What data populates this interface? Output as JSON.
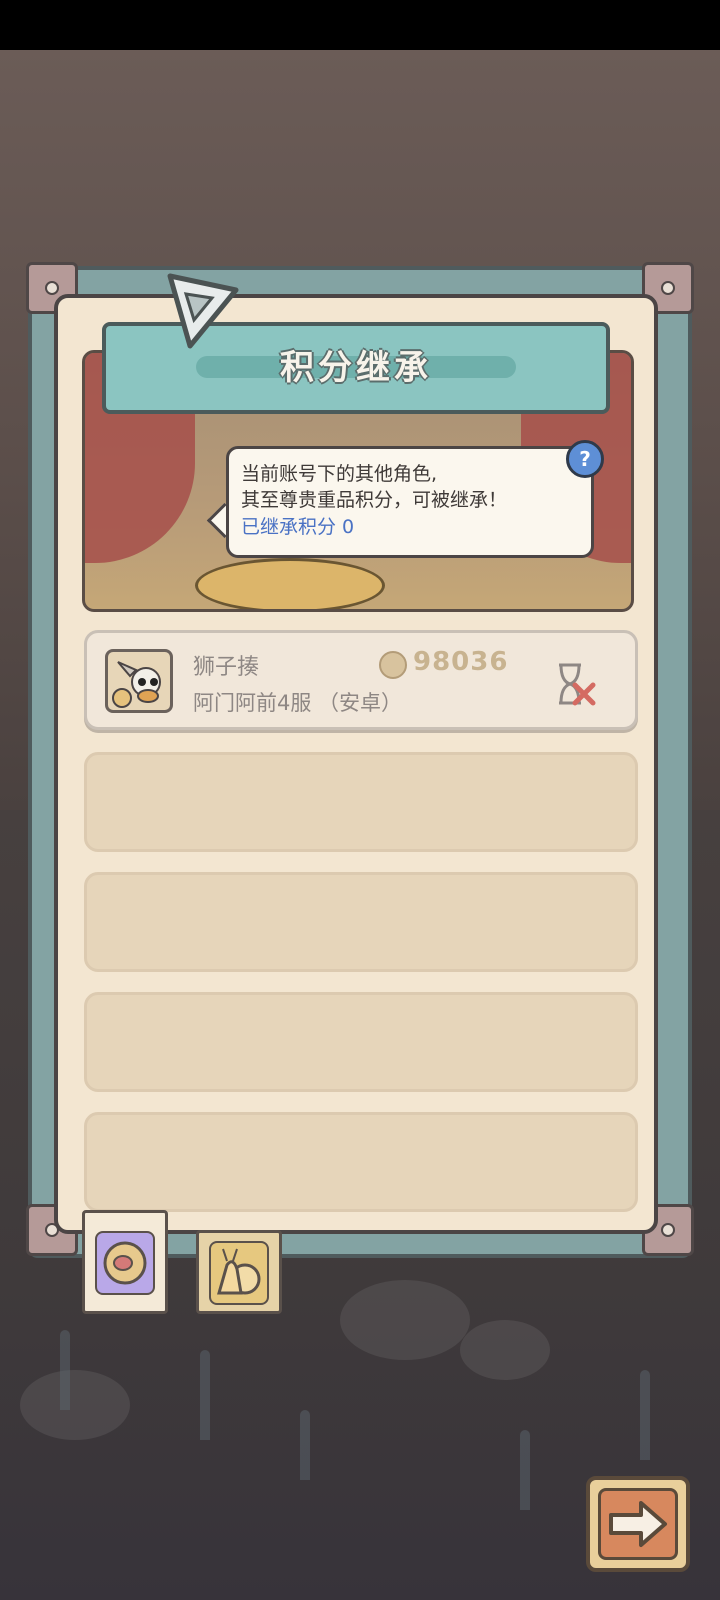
{
  "dialog": {
    "title": "积分继承",
    "message_line1": "当前账号下的其他角色,",
    "message_line2": "其至尊贵重品积分，可被继承！",
    "inherited_label": "已继承积分  0",
    "help_label": "?"
  },
  "characters": [
    {
      "name": "狮子揍",
      "server": "阿门阿前4服 （安卓）",
      "points": "98036",
      "status_icon": "hourglass-cancel-icon"
    }
  ],
  "empty_slots": 4,
  "tabs": [
    {
      "name": "points-tab",
      "icon": "coin-meat-icon",
      "active": true
    },
    {
      "name": "snail-tab",
      "icon": "snail-icon",
      "active": false
    }
  ],
  "colors": {
    "panel_bg": "#f3e6d1",
    "frame": "#83a3a3",
    "title_banner": "#8bc5c1",
    "inherited_text": "#4a72c4",
    "next_button": "#d7885e"
  }
}
